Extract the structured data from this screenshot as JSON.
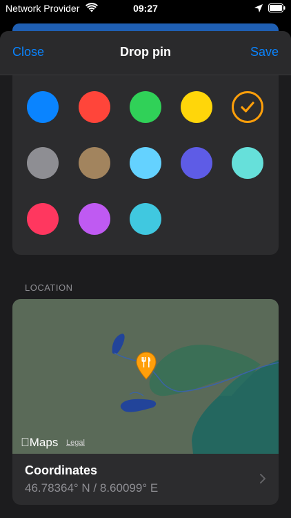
{
  "status_bar": {
    "carrier": "Network Provider",
    "time": "09:27",
    "icons": [
      "wifi-icon",
      "location-arrow-icon",
      "battery-icon"
    ]
  },
  "nav": {
    "close_label": "Close",
    "title": "Drop pin",
    "save_label": "Save"
  },
  "colors": {
    "swatches": [
      "#0a84ff",
      "#ff453a",
      "#30d158",
      "#ffd60a",
      "#ff9f0a",
      "#8e8e93",
      "#a2845e",
      "#64d2ff",
      "#5e5ce6",
      "#66e0da",
      "#ff375f",
      "#bf5af2",
      "#40c8e0"
    ],
    "selected": "#ff9f0a"
  },
  "location": {
    "section_label": "LOCATION",
    "map_brand": "Maps",
    "map_legal": "Legal",
    "pin_icon": "fork-knife-icon",
    "coordinates_title": "Coordinates",
    "coordinates_value": "46.78364° N / 8.60099° E"
  }
}
